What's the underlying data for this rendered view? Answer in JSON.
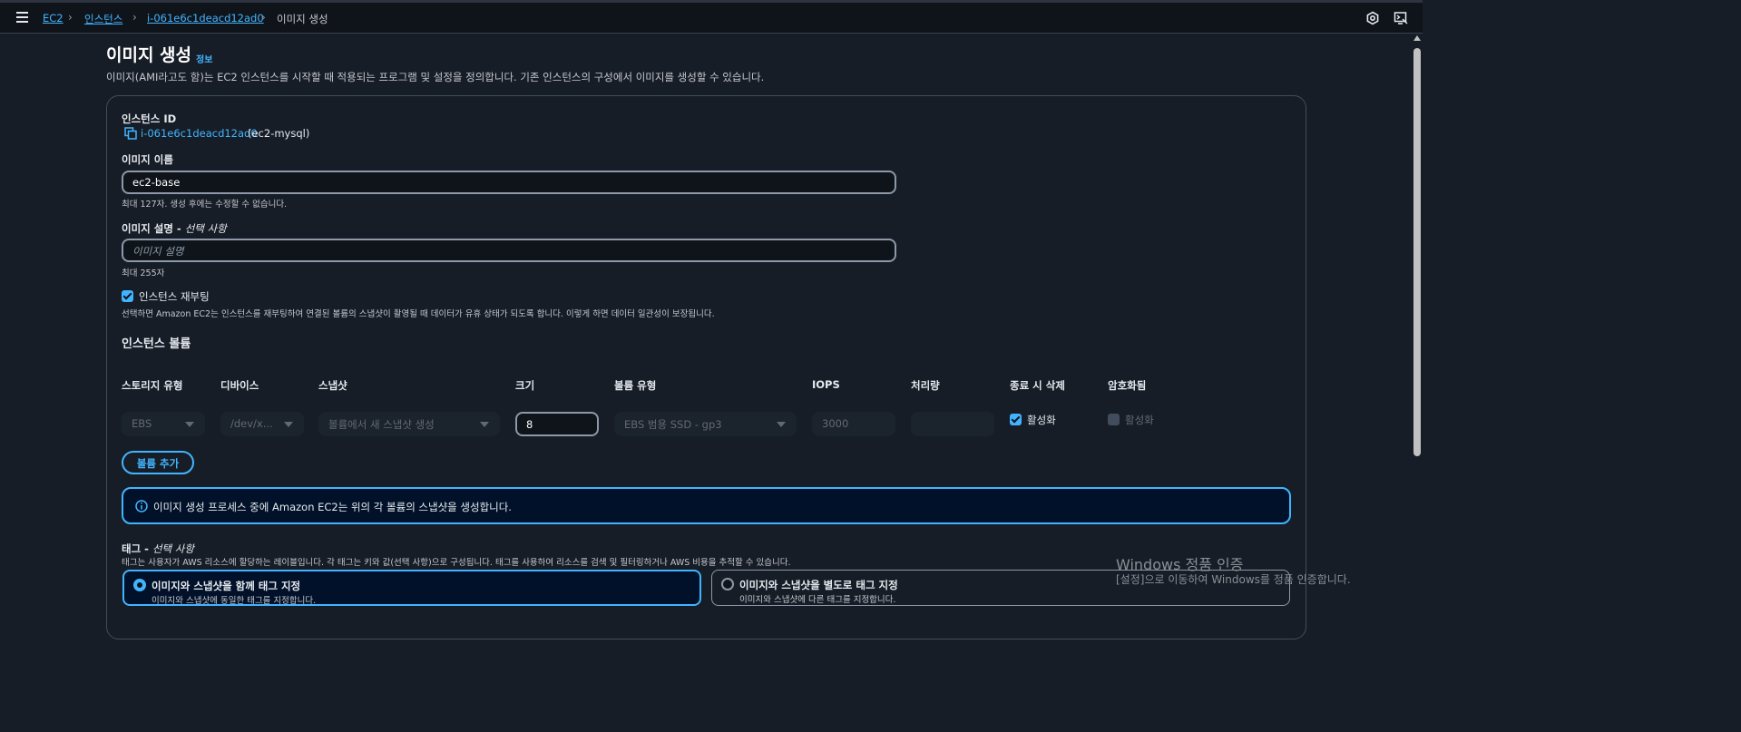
{
  "breadcrumb": {
    "items": [
      "EC2",
      "인스턴스",
      "i-061e6c1deacd12ad0"
    ],
    "current": "이미지 생성"
  },
  "page": {
    "title": "이미지 생성",
    "info_link": "정보",
    "description": "이미지(AMI라고도 함)는 EC2 인스턴스를 시작할 때 적용되는 프로그램 및 설정을 정의합니다. 기존 인스턴스의 구성에서 이미지를 생성할 수 있습니다."
  },
  "form": {
    "instance_id_label": "인스턴스 ID",
    "instance_id_value": "i-061e6c1deacd12ad0",
    "instance_id_name": "(ec2-mysql)",
    "image_name_label": "이미지 이름",
    "image_name_value": "ec2-base",
    "image_name_hint": "최대 127자. 생성 후에는 수정할 수 없습니다.",
    "image_desc_label": "이미지 설명 - ",
    "image_desc_optional": "선택 사항",
    "image_desc_placeholder": "이미지 설명",
    "image_desc_hint": "최대 255자",
    "reboot_label": "인스턴스 재부팅",
    "reboot_checked": true,
    "reboot_hint": "선택하면 Amazon EC2는 인스턴스를 재부팅하여 연결된 볼륨의 스냅샷이 촬영될 때 데이터가 유휴 상태가 되도록 합니다. 이렇게 하면 데이터 일관성이 보장됩니다."
  },
  "volumes": {
    "title": "인스턴스 볼륨",
    "headers": [
      "스토리지 유형",
      "디바이스",
      "스냅샷",
      "크기",
      "볼륨 유형",
      "IOPS",
      "처리량",
      "종료 시 삭제",
      "암호화됨"
    ],
    "row": {
      "storage_type": "EBS",
      "device": "/dev/x...",
      "snapshot": "볼륨에서 새 스냅샷 생성",
      "size": "8",
      "volume_type": "EBS 범용 SSD - gp3",
      "iops": "3000",
      "throughput": "",
      "delete_on_termination": "활성화",
      "delete_on_termination_checked": true,
      "encrypted": "활성화",
      "encrypted_checked": false
    },
    "add_button": "볼륨 추가",
    "info_message": "이미지 생성 프로세스 중에 Amazon EC2는 위의 각 볼륨의 스냅샷을 생성합니다."
  },
  "tags": {
    "title": "태그 - ",
    "optional": "선택 사항",
    "description": "태그는 사용자가 AWS 리소스에 할당하는 레이블입니다. 각 태그는 키와 값(선택 사항)으로 구성됩니다. 태그를 사용하여 리소스를 검색 및 필터링하거나 AWS 비용을 추적할 수 있습니다.",
    "options": [
      {
        "label": "이미지와 스냅샷을 함께 태그 지정",
        "sub": "이미지와 스냅샷에 동일한 태그를 지정합니다.",
        "selected": true
      },
      {
        "label": "이미지와 스냅샷을 별도로 태그 지정",
        "sub": "이미지와 스냅샷에 다른 태그를 지정합니다.",
        "selected": false
      }
    ]
  },
  "watermark": {
    "line1": "Windows 정품 인증",
    "line2": "[설정]으로 이동하여 Windows를 정품 인증합니다."
  },
  "colors": {
    "accent": "#42b4ff",
    "background": "#161d26",
    "header": "#0f141a"
  }
}
